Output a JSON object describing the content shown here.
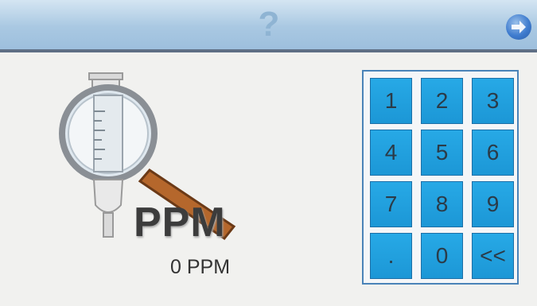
{
  "header": {
    "help_label": "?",
    "next_icon": "arrow-right-icon"
  },
  "display": {
    "logo_text": "PPM",
    "reading": "0 PPM",
    "illustration_icon": "hydrometer-magnifier-icon"
  },
  "keypad": {
    "keys": [
      "1",
      "2",
      "3",
      "4",
      "5",
      "6",
      "7",
      "8",
      "9",
      ".",
      "0",
      "<<"
    ]
  },
  "colors": {
    "key_blue": "#1c97d6",
    "header_blue": "#a9c8e2"
  }
}
